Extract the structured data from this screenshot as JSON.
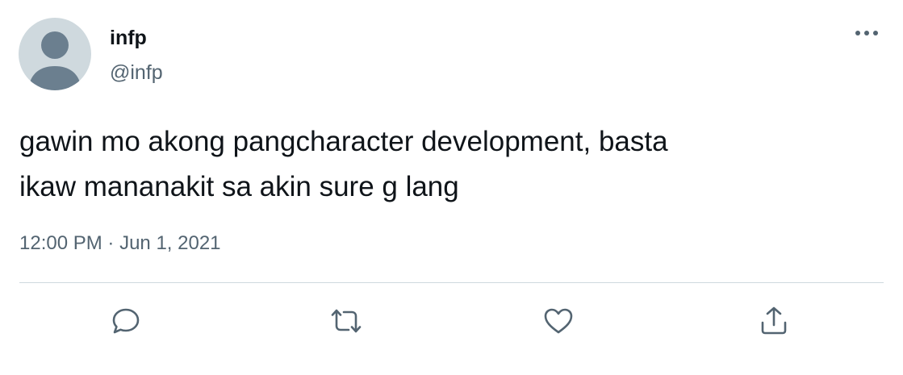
{
  "user": {
    "display_name": "infp",
    "handle": "@infp"
  },
  "tweet": {
    "lines": [
      "gawin mo akong pangcharacter development, basta",
      "ikaw mananakit sa akin sure g lang"
    ],
    "time": "12:00 PM",
    "separator": "·",
    "date": "Jun 1, 2021"
  },
  "icons": {
    "more": "more-horizontal-icon",
    "reply": "reply-icon",
    "retweet": "retweet-icon",
    "like": "heart-icon",
    "share": "share-icon"
  },
  "colors": {
    "text": "#0f1419",
    "secondary": "#536471",
    "divider": "#cfd9de",
    "avatar_bg": "#cfd9de",
    "avatar_fg": "#6b7f8f"
  }
}
